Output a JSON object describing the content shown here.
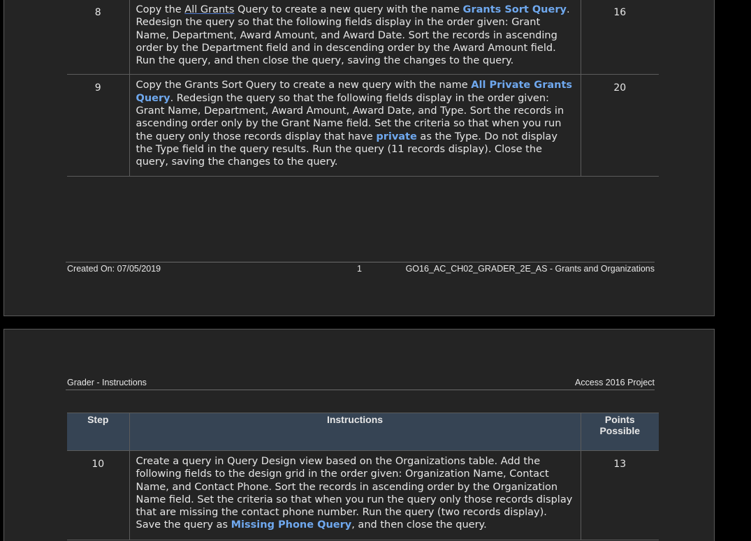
{
  "table_header": {
    "step": "Step",
    "instructions": "Instructions",
    "points_line1": "Points",
    "points_line2": "Possible"
  },
  "steps": [
    {
      "num": "8",
      "points": "16",
      "parts": [
        {
          "t": "Copy the ",
          "s": ""
        },
        {
          "t": "All Grants",
          "s": "squiggle"
        },
        {
          "t": " Query to create a new query with the name ",
          "s": ""
        },
        {
          "t": "Grants Sort Query",
          "s": "hl"
        },
        {
          "t": ". Redesign the query so that the following fields display in the order given: Grant Name, Department, Award Amount, and Award Date. Sort the records in ascending order by the Department field and in descending order by the Award Amount field. Run the query, and then close the query, saving the changes to the query.",
          "s": ""
        }
      ]
    },
    {
      "num": "9",
      "points": "20",
      "parts": [
        {
          "t": "Copy the Grants Sort Query to create a new query with the name ",
          "s": ""
        },
        {
          "t": "All Private Grants Query",
          "s": "hl"
        },
        {
          "t": ". Redesign the query so that the following fields display in the order given: Grant Name, Department, Award Amount, Award Date, and Type. Sort the records in ascending order only by the Grant Name field. Set the criteria so that when you run the query only those records display that have ",
          "s": ""
        },
        {
          "t": "private",
          "s": "hl"
        },
        {
          "t": " as the Type. Do not display the Type field in the query results. Run the query (11 records display). Close the query, saving the changes to the query.",
          "s": ""
        }
      ]
    },
    {
      "num": "10",
      "points": "13",
      "parts": [
        {
          "t": "Create a query in Query Design view based on the Organizations table. Add the following fields to the design grid in the order given: Organization Name, Contact Name, and Contact Phone. Sort the records in ascending order by the Organization Name field. Set the criteria so that when you run the query only those records display that are missing the contact phone number. Run the query (two records display). Save the query as ",
          "s": ""
        },
        {
          "t": "Missing Phone Query",
          "s": "hl"
        },
        {
          "t": ", and then close the query.",
          "s": ""
        }
      ]
    }
  ],
  "footer": {
    "created": "Created On: 07/05/2019",
    "page_number": "1",
    "doc_name": "GO16_AC_CH02_GRADER_2E_AS - Grants and Organizations"
  },
  "header": {
    "left": "Grader - Instructions",
    "right": "Access 2016 Project"
  }
}
